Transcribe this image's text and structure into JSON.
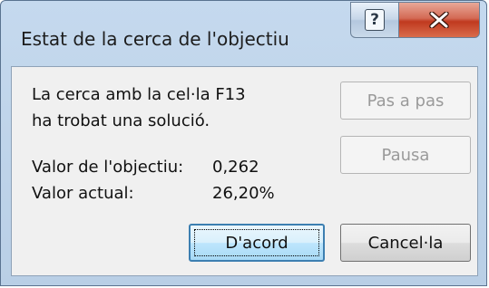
{
  "window": {
    "title": "Estat de la cerca de l'objectiu",
    "help_glyph": "?",
    "close_glyph": "X"
  },
  "message": {
    "line1": "La cerca amb la cel·la F13",
    "line2": "ha trobat una solució."
  },
  "values": {
    "target_label": "Valor de l'objectiu:",
    "target_value": "0,262",
    "current_label": "Valor actual:",
    "current_value": "26,20%"
  },
  "buttons": {
    "step": "Pas a pas",
    "pause": "Pausa",
    "ok": "D'acord",
    "cancel": "Cancel·la"
  },
  "icons": {
    "help": "help-icon",
    "close": "close-icon"
  },
  "colors": {
    "close_button": "#c8462c",
    "default_button_border": "#3c7fb1"
  }
}
